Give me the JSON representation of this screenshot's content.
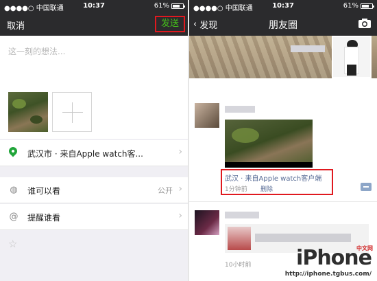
{
  "left": {
    "status": {
      "carrier": "●●●●○ 中国联通",
      "time": "10:37",
      "battery": "61%"
    },
    "nav": {
      "cancel": "取消",
      "send": "发送"
    },
    "compose": {
      "placeholder": "这一刻的想法..."
    },
    "location": {
      "label": "武汉市 · 来自Apple watch客..."
    },
    "visibility": {
      "label": "谁可以看",
      "value": "公开"
    },
    "remind": {
      "label": "提醒谁看"
    },
    "icons": {
      "location": "location-pin-icon",
      "globe": "globe-icon",
      "at": "at-icon",
      "star": "star-icon",
      "plus": "plus-icon"
    },
    "colors": {
      "send": "#45c01a",
      "highlight": "#e0191f",
      "pin": "#21a53a"
    }
  },
  "right": {
    "status": {
      "carrier": "●●●●○ 中国联通",
      "time": "10:37",
      "battery": "61%"
    },
    "nav": {
      "back": "发现",
      "title": "朋友圈"
    },
    "post1": {
      "location": "武汉 · 来自Apple watch客户端",
      "time": "1分钟前",
      "delete": "删除"
    },
    "post2": {
      "time": "10小时前"
    },
    "colors": {
      "link": "#576b95"
    }
  },
  "watermark": {
    "brand": "iPhone",
    "cn": "中文网",
    "url": "http://iphone.tgbus.com/"
  }
}
